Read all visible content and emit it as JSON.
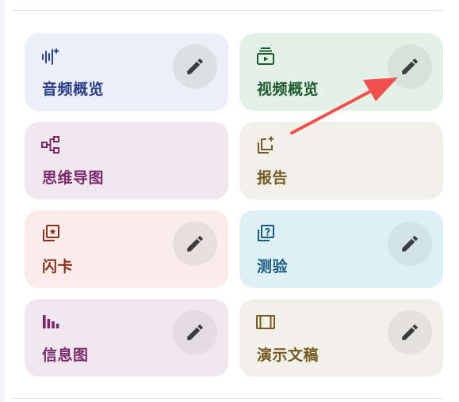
{
  "colors": {
    "blue_bg": "#eceff9",
    "blue_fg": "#2b3f86",
    "green_bg": "#e3f1e6",
    "green_fg": "#1e5a2f",
    "purple_bg": "#f1e8ef",
    "purple_fg": "#7a2a6a",
    "beige_bg": "#f2f1e9",
    "beige_fg": "#735a22",
    "pink_bg": "#f9ece9",
    "pink_fg": "#8a3220",
    "cyan_bg": "#def0f5",
    "cyan_fg": "#1b5c80",
    "edit_circle": "#dedfe3",
    "arrow": "#f0504e"
  },
  "cards": [
    {
      "label": "音频概览",
      "icon": "audio-spark-icon",
      "editable": true
    },
    {
      "label": "视频概览",
      "icon": "video-icon",
      "editable": true
    },
    {
      "label": "思维导图",
      "icon": "mind-map-icon",
      "editable": false
    },
    {
      "label": "报告",
      "icon": "report-spark-icon",
      "editable": false
    },
    {
      "label": "闪卡",
      "icon": "flashcard-icon",
      "editable": true
    },
    {
      "label": "测验",
      "icon": "quiz-icon",
      "editable": true
    },
    {
      "label": "信息图",
      "icon": "infographic-icon",
      "editable": true
    },
    {
      "label": "演示文稿",
      "icon": "slides-icon",
      "editable": true
    }
  ]
}
